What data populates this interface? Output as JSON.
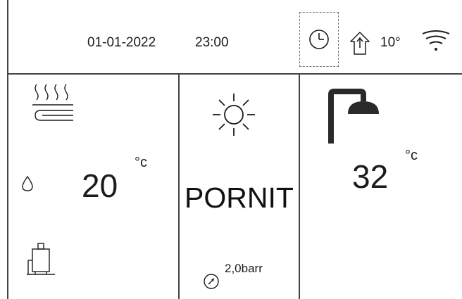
{
  "header": {
    "date": "01-01-2022",
    "time": "23:00",
    "outdoor_temp": "10°",
    "icons": [
      "clock-icon",
      "house-outdoor-icon",
      "wifi-icon"
    ]
  },
  "heating": {
    "icon": "underfloor-heating-icon",
    "setpoint": "20",
    "unit": "°c",
    "water_icon": "water-drop-icon",
    "tank_icon": "boiler-tank-icon"
  },
  "mode": {
    "icon": "sun-icon",
    "label": "PORNIT",
    "pressure": "2,0barr",
    "pressure_icon": "pressure-gauge-icon"
  },
  "hot_water": {
    "icon": "shower-icon",
    "setpoint": "32",
    "unit": "°c"
  },
  "colors": {
    "line": "#444444",
    "text": "#1c1c1c",
    "shower": "#2a2a2a"
  }
}
